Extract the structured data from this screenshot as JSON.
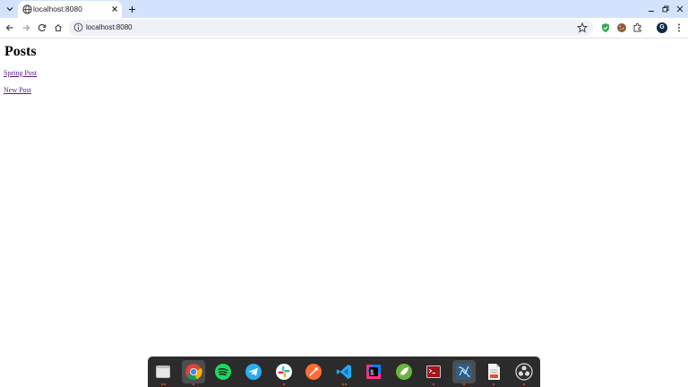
{
  "browser": {
    "tab_title": "localhost:8080",
    "url": "localhost:8080",
    "profile_initial": "G"
  },
  "page": {
    "title": "Posts",
    "links": [
      "Spring Post",
      "New Post"
    ]
  },
  "dock": {
    "apps": [
      "files-icon",
      "chrome-icon",
      "spotify-icon",
      "telegram-icon",
      "slack-icon",
      "postman-icon",
      "vscode-icon",
      "intellij-icon",
      "spring-icon",
      "terminal-icon",
      "mysql-workbench-icon",
      "text-editor-icon",
      "obs-icon"
    ]
  },
  "colors": {
    "tabstrip_bg": "#d3e3fd",
    "link_visited": "#551a8b",
    "dock_bg": "#2b2b2b"
  }
}
